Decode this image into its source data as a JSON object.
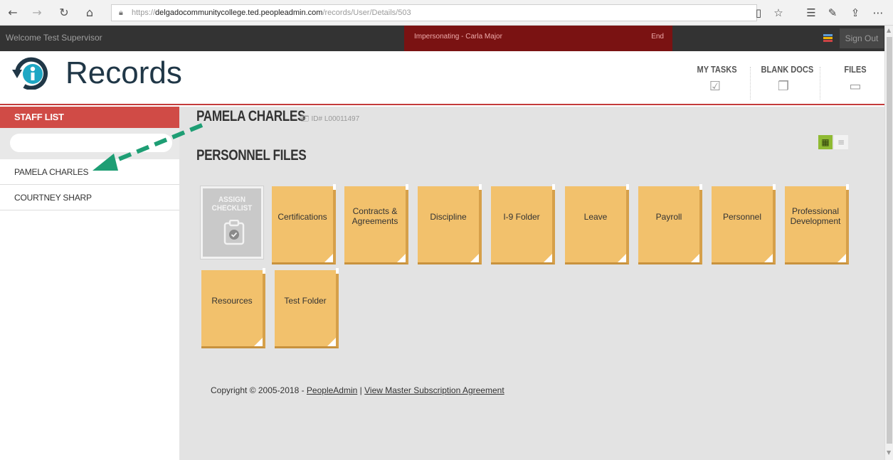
{
  "browser": {
    "url_prefix": "https://",
    "url_host": "delgadocommunitycollege.ted.peopleadmin.com",
    "url_path": "/records/User/Details/503",
    "icons": [
      "back-icon",
      "forward-icon",
      "refresh-icon",
      "home-icon",
      "lock-icon",
      "reading-view-icon",
      "favorite-star-icon",
      "favorites-list-icon",
      "pen-icon",
      "share-icon",
      "more-icon"
    ]
  },
  "topbar": {
    "welcome": "Welcome Test Supervisor",
    "impersonating": "Impersonating  -  Carla Major",
    "end": "End",
    "sign_out": "Sign Out"
  },
  "header": {
    "logo_text": "Records",
    "nav": [
      {
        "label": "MY TASKS",
        "icon": "task-checkbox-icon"
      },
      {
        "label": "BLANK DOCS",
        "icon": "documents-icon"
      },
      {
        "label": "FILES",
        "icon": "inbox-icon"
      }
    ]
  },
  "sidebar": {
    "title": "STAFF LIST",
    "search_value": "",
    "staff": [
      "PAMELA CHARLES",
      "COURTNEY SHARP"
    ]
  },
  "main": {
    "employee_name": "PAMELA CHARLES",
    "employee_id": "ID# L00011497",
    "section_title": "PERSONNEL FILES",
    "assign_label_line1": "ASSIGN",
    "assign_label_line2": "CHECKLIST",
    "folders": [
      "Certifications",
      "Contracts & Agreements",
      "Discipline",
      "I-9 Folder",
      "Leave",
      "Payroll",
      "Personnel",
      "Professional Development",
      "Resources",
      "Test Folder"
    ],
    "view_modes": [
      "grid-view-icon",
      "list-view-icon"
    ]
  },
  "footer": {
    "copyright": "Copyright © 2005-2018 - ",
    "brand_link": "PeopleAdmin",
    "separator": " | ",
    "agreement_link": "View Master Subscription Agreement"
  },
  "colors": {
    "topbar": "#333333",
    "impersonation": "#7a1212",
    "accent_red": "#d04b46",
    "folder": "#f2c16c",
    "annotation_arrow": "#1e9e74",
    "grid_toggle": "#8fba33"
  }
}
